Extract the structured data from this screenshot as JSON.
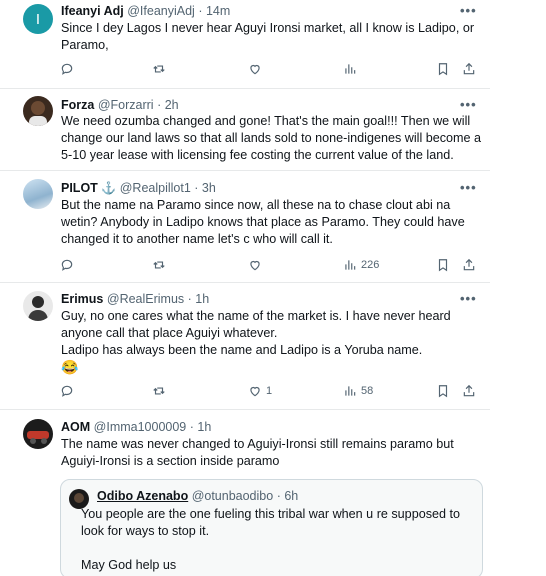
{
  "tweets": [
    {
      "name": "Ifeanyi Adj",
      "handle": "@IfeanyiAdj",
      "time": "· 14m",
      "body": "Since I dey Lagos I never hear Aguyi Ironsi market, all I know is Ladipo, or Paramo,",
      "actions": {
        "reply": "",
        "retweet": "",
        "like": "",
        "views": ""
      }
    },
    {
      "name": "Forza",
      "handle": "@Forzarri",
      "time": "· 2h",
      "body": "We need ozumba changed and gone! That's the main goal!!! Then we will change our land laws so that all lands sold to none-indigenes will become a 5-10 year lease with licensing fee costing the current value of the land."
    },
    {
      "name": "PILOT",
      "handle": "@Realpillot1",
      "time": "· 3h",
      "body": "But the name na Paramo since now, all these na to chase clout abi na wetin? Anybody in Ladipo knows that place as Paramo. They could have changed it to another name let's c who will call it.",
      "actions": {
        "reply": "",
        "retweet": "",
        "like": "",
        "views": "226"
      }
    },
    {
      "name": "Erimus",
      "handle": "@RealErimus",
      "time": "· 1h",
      "body_lines": [
        "Guy, no one cares what the name of the market is. I have never heard anyone call that place Aguiyi whatever.",
        "Ladipo has always been the name and Ladipo is a Yoruba name."
      ],
      "emoji": "😂",
      "actions": {
        "reply": "",
        "retweet": "",
        "like": "1",
        "views": "58"
      }
    },
    {
      "name": "AOM",
      "handle": "@Imma1000009",
      "time": "· 1h",
      "body": "The name was never changed to Aguiyi-Ironsi still remains paramo but Aguiyi-Ironsi is a section inside paramo",
      "quote": {
        "name": "Odibo Azenabo",
        "handle": "@otunbaodibo",
        "time": "· 6h",
        "body": "You people are the one fueling this tribal war when u re supposed to look for ways to stop it.",
        "body2": "May God help us"
      }
    }
  ],
  "ui": {
    "more": "•••"
  },
  "colors": {
    "text": "#0f1419",
    "secondary": "#536471",
    "avatar_teal": "#1a9aa6",
    "verified_blue": "#1d9bf0",
    "border": "#cfd9de"
  }
}
